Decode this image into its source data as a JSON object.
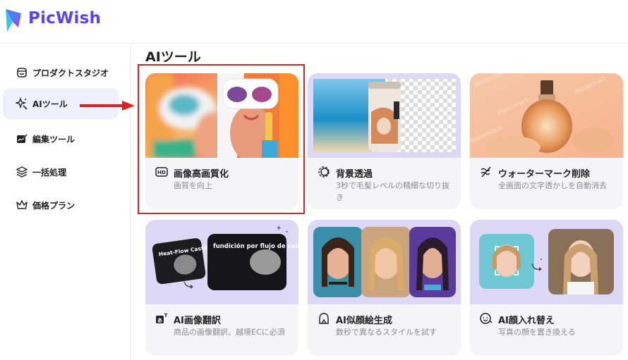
{
  "app": {
    "brand": "PicWish",
    "brand_color": "#5a43f0",
    "logo_icon": "picwish-logo-icon"
  },
  "sidebar": {
    "items": [
      {
        "label": "プロダクトスタジオ",
        "icon": "studio-icon",
        "active": false
      },
      {
        "label": "AIツール",
        "icon": "ai-sparkle-icon",
        "active": true
      },
      {
        "label": "編集ツール",
        "icon": "edit-icon",
        "active": false
      },
      {
        "label": "一括処理",
        "icon": "layers-icon",
        "active": false
      },
      {
        "label": "価格プラン",
        "icon": "crown-icon",
        "active": false
      }
    ]
  },
  "main": {
    "title": "AIツール",
    "cards": [
      {
        "title": "画像高画質化",
        "desc": "画質を向上",
        "icon": "hd-icon"
      },
      {
        "title": "背景透過",
        "desc": "3秒で毛髪レベルの精細な切り抜き",
        "icon": "cutout-icon"
      },
      {
        "title": "ウォーターマーク削除",
        "desc": "全画面の文字透かしを自動消去",
        "icon": "watermark-remove-icon"
      },
      {
        "title": "AI画像翻訳",
        "desc": "商品の画像翻訳、越境ECに必須",
        "icon": "translate-icon"
      },
      {
        "title": "AI似顔絵生成",
        "desc": "数秒で異なるスタイルを試す",
        "icon": "portrait-icon"
      },
      {
        "title": "AI顔入れ替え",
        "desc": "写真の顔を置き換える",
        "icon": "face-swap-icon"
      }
    ],
    "translate_card_texts": {
      "small_card": "Heat-Flow Casting",
      "big_card": "fundición por flujo de calor"
    }
  },
  "annotation": {
    "highlight_color": "#e02020"
  }
}
